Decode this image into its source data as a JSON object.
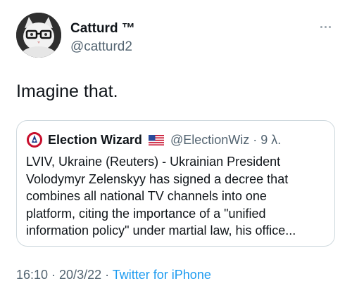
{
  "author": {
    "display_name": "Catturd ™",
    "handle": "@catturd2",
    "avatar_icon": "cat-with-glasses-avatar-icon"
  },
  "more_icon": "more-horizontal-icon",
  "tweet": {
    "text": "Imagine that."
  },
  "quoted_tweet": {
    "display_name": "Election Wizard",
    "flag_icon": "us-flag-icon",
    "handle_time": "@ElectionWiz · 9 λ.",
    "lines": [
      "LVIV, Ukraine (Reuters) - Ukrainian President",
      "Volodymyr Zelenskyy has signed a decree that",
      "combines all national TV channels into one",
      "platform, citing the importance of a \"unified",
      "information policy\" under martial law, his office..."
    ]
  },
  "footer": {
    "timestamp": "16:10 · 20/3/22 · ",
    "source": "Twitter for iPhone"
  },
  "colors": {
    "text": "#0f1419",
    "secondary": "#536471",
    "link": "#1d9bf0",
    "border": "#cfd9de"
  }
}
